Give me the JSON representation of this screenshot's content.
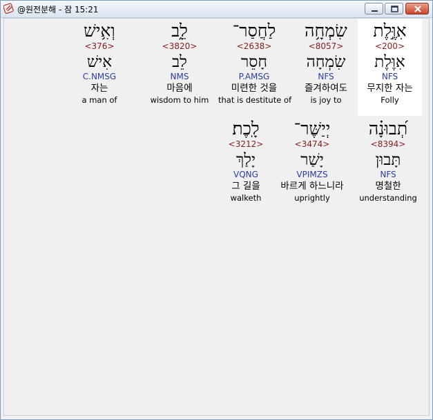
{
  "window": {
    "title": "@원전분해 - 잠 15:21",
    "buttons": {
      "minimize": "minimize-icon",
      "maximize": "maximize-icon",
      "close": "close-icon"
    },
    "colors": {
      "strong": "#8b1a1a",
      "parse": "#2b3aa8",
      "highlight": "#ffffff"
    }
  },
  "rows": [
    {
      "words": [
        {
          "hebrew": "וְאִ֥ישׁ",
          "strong": "<376>",
          "lemma": "אִישׁ",
          "parse": "C.NMSG",
          "korean": "자는",
          "english": "a man of"
        },
        {
          "hebrew": "לֵ֑ב",
          "strong": "<3820>",
          "lemma": "לֵב",
          "parse": "NMS",
          "korean": "마음에",
          "english": "wisdom to him"
        },
        {
          "hebrew": "לַחֲסַר־",
          "strong": "<2638>",
          "lemma": "חָסֵר",
          "parse": "P.AMSG",
          "korean": "미련한 것을",
          "english": "that is destitute of"
        },
        {
          "hebrew": "שִׂמְחָ֥ה",
          "strong": "<8057>",
          "lemma": "שִׂמְחָה",
          "parse": "NFS",
          "korean": "즐겨하여도",
          "english": "is joy to"
        },
        {
          "hebrew": "אִוֶּ֣לֶת",
          "strong": "<200>",
          "lemma": "אִוֶּלֶת",
          "parse": "NFS",
          "korean": "무지한 자는",
          "english": "Folly",
          "selected": true
        }
      ]
    },
    {
      "words": [
        {
          "hebrew": "לָֽכֶת׃",
          "strong": "<3212>",
          "lemma": "יָלַךְ",
          "parse": "VQNG",
          "korean": "그 길을",
          "english": "walketh"
        },
        {
          "hebrew": "יְיַשֶּׁר־",
          "strong": "<3474>",
          "lemma": "יָשַׁר",
          "parse": "VPIMZS",
          "korean": "바르게 하느니라",
          "english": "uprightly"
        },
        {
          "hebrew": "תְ֝בוּנָ֗ה",
          "strong": "<8394>",
          "lemma": "תָּבוּן",
          "parse": "NFS",
          "korean": "명철한",
          "english": "understanding"
        }
      ]
    }
  ]
}
